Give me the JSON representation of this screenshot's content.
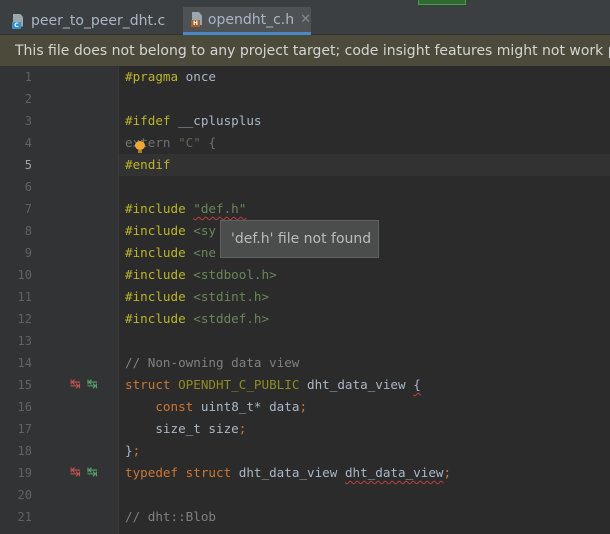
{
  "tabs": [
    {
      "label": "peer_to_peer_dht.c",
      "icon": "c-file-icon",
      "active": false
    },
    {
      "label": "opendht_c.h",
      "icon": "h-file-icon",
      "active": true,
      "close": "✕"
    }
  ],
  "banner": {
    "text": "This file does not belong to any project target; code insight features might not work properly."
  },
  "editor": {
    "current_line": 5,
    "lines": [
      {
        "num": "1",
        "tokens": [
          [
            "pp",
            "#pragma"
          ],
          [
            "",
            "once"
          ]
        ]
      },
      {
        "num": "2",
        "tokens": []
      },
      {
        "num": "3",
        "tokens": [
          [
            "pp",
            "#ifdef"
          ],
          [
            "",
            "__cplusplus"
          ]
        ]
      },
      {
        "num": "4",
        "tokens": [
          [
            "dim",
            "extern"
          ],
          [
            "dimstr",
            "\"C\""
          ],
          [
            "dim",
            "{"
          ]
        ]
      },
      {
        "num": "5",
        "tokens": [
          [
            "pp",
            "#endif"
          ]
        ]
      },
      {
        "num": "6",
        "tokens": []
      },
      {
        "num": "7",
        "tokens": [
          [
            "pp",
            "#include"
          ],
          [
            "str",
            "\"def.h\""
          ]
        ]
      },
      {
        "num": "8",
        "tokens": [
          [
            "pp",
            "#include"
          ],
          [
            "str",
            "<sy"
          ]
        ]
      },
      {
        "num": "9",
        "tokens": [
          [
            "pp",
            "#include"
          ],
          [
            "str",
            "<ne"
          ]
        ]
      },
      {
        "num": "10",
        "tokens": [
          [
            "pp",
            "#include"
          ],
          [
            "str",
            "<stdbool.h>"
          ]
        ]
      },
      {
        "num": "11",
        "tokens": [
          [
            "pp",
            "#include"
          ],
          [
            "str",
            "<stdint.h>"
          ]
        ]
      },
      {
        "num": "12",
        "tokens": [
          [
            "pp",
            "#include"
          ],
          [
            "str",
            "<stddef.h>"
          ]
        ]
      },
      {
        "num": "13",
        "tokens": []
      },
      {
        "num": "14",
        "tokens": [
          [
            "com",
            "// Non-owning data view"
          ]
        ]
      },
      {
        "num": "15",
        "tokens": [
          [
            "kw",
            "struct"
          ],
          [
            "macro",
            "OPENDHT_C_PUBLIC"
          ],
          [
            "",
            "dht_data_view"
          ],
          [
            "",
            "{"
          ]
        ]
      },
      {
        "num": "16",
        "tokens": [
          [
            "",
            "    "
          ],
          [
            "kw",
            "const"
          ],
          [
            "",
            "uint8_t* data"
          ],
          [
            "kw",
            ";"
          ]
        ]
      },
      {
        "num": "17",
        "tokens": [
          [
            "",
            "    size_t size"
          ],
          [
            "kw",
            ";"
          ]
        ]
      },
      {
        "num": "18",
        "tokens": [
          [
            "",
            "}"
          ],
          [
            "kw",
            ";"
          ]
        ]
      },
      {
        "num": "19",
        "tokens": [
          [
            "kw",
            "typedef"
          ],
          [
            "kw",
            "struct"
          ],
          [
            "",
            "dht_data_view"
          ],
          [
            "",
            "dht_data_view"
          ],
          [
            "kw",
            ";"
          ]
        ]
      },
      {
        "num": "20",
        "tokens": []
      },
      {
        "num": "21",
        "tokens": [
          [
            "com",
            "// dht::Blob"
          ]
        ]
      }
    ]
  },
  "gutter_markers": [
    {
      "line": 15,
      "glyph_left": "↹",
      "glyph_right": "↹"
    },
    {
      "line": 19,
      "glyph_left": "↹",
      "glyph_right": "↹"
    }
  ],
  "tooltip": {
    "text": "'def.h' file not found"
  }
}
